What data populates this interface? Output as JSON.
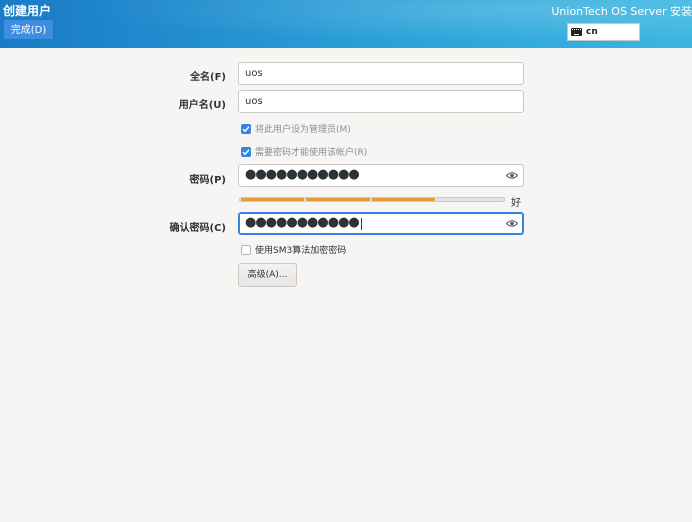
{
  "header": {
    "title": "创建用户",
    "done_label": "完成(D)",
    "product_title": "UnionTech OS Server 安装",
    "keyboard_layout": "cn",
    "keyboard_icon": "keyboard-icon"
  },
  "form": {
    "fullname_label": "全名(F)",
    "fullname_value": "uos",
    "username_label": "用户名(U)",
    "username_value": "uos",
    "admin_checkbox_label": "将此用户设为管理员(M)",
    "admin_checked": true,
    "require_password_label": "需要密码才能使用该帐户(R)",
    "require_password_checked": true,
    "password_label": "密码(P)",
    "password_mask": "●●●●●●●●●●●",
    "strength_fraction": 0.74,
    "strength_text": "好",
    "confirm_label": "确认密码(C)",
    "confirm_mask": "●●●●●●●●●●●",
    "sm3_label": "使用SM3算法加密密码",
    "sm3_checked": false,
    "advanced_label": "高级(A)...",
    "reveal_icon": "eye-icon"
  },
  "colors": {
    "accent": "#3584e4",
    "header_start": "#1a7bc6",
    "header_end": "#3bb6e2",
    "strength_bar": "#e29d3a",
    "background": "#f6f5f4"
  }
}
